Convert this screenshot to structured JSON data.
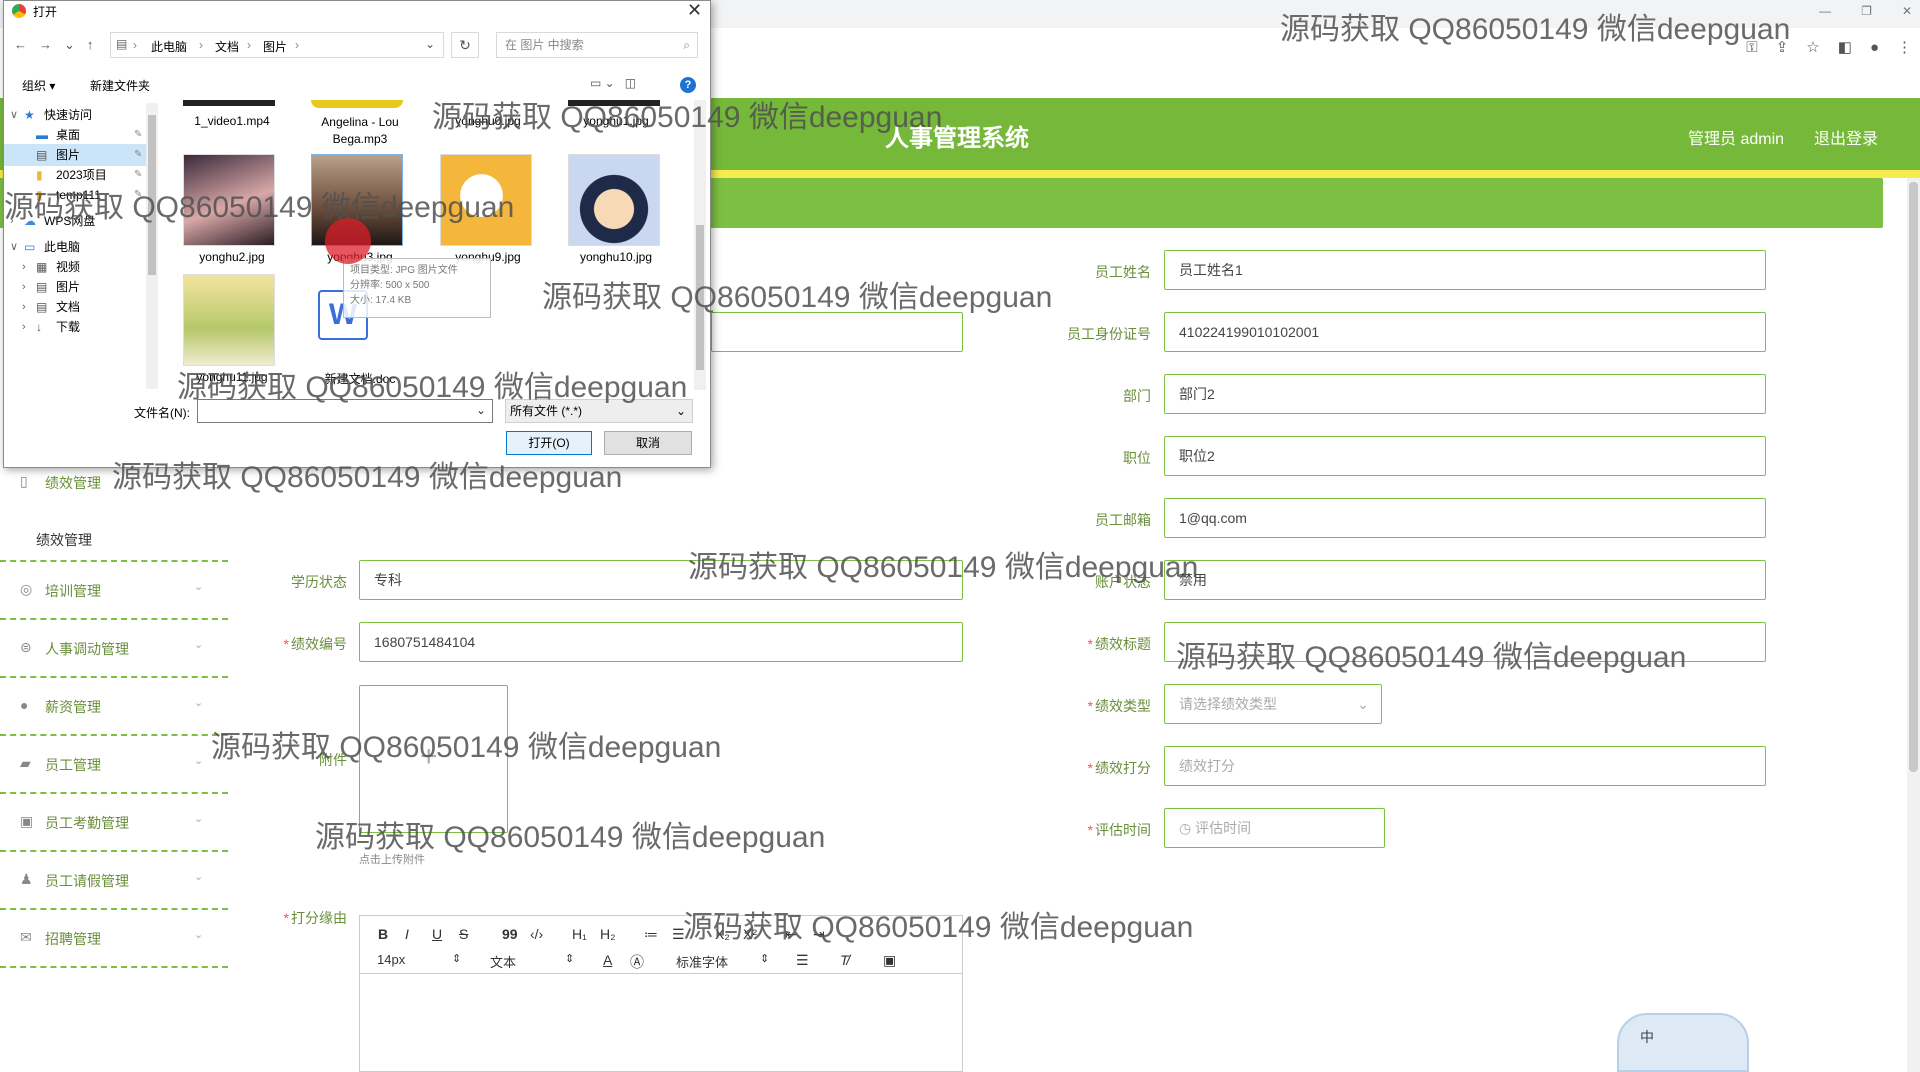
{
  "browser": {
    "window_controls": [
      "—",
      "❐",
      "✕"
    ],
    "toolbar_icons": [
      "key-icon",
      "share-icon",
      "star-icon",
      "sidebar-icon",
      "profile-icon",
      "menu-icon"
    ]
  },
  "app": {
    "title": "人事管理系统",
    "admin": "管理员 admin",
    "logout": "退出登录",
    "colors": {
      "header": "#76b83a",
      "accent_bar": "#f7ec4e",
      "label": "#6a8f3a"
    }
  },
  "sidebar": {
    "items": [
      {
        "label": "绩效管理",
        "icon": "clipboard-icon"
      },
      {
        "label": "培训管理",
        "icon": "target-icon"
      },
      {
        "label": "人事调动管理",
        "icon": "transfer-icon"
      },
      {
        "label": "薪资管理",
        "icon": "money-icon"
      },
      {
        "label": "员工管理",
        "icon": "people-icon"
      },
      {
        "label": "员工考勤管理",
        "icon": "calendar-icon"
      },
      {
        "label": "员工请假管理",
        "icon": "person-icon"
      },
      {
        "label": "招聘管理",
        "icon": "mail-icon"
      }
    ],
    "sub_item": "绩效管理"
  },
  "form": {
    "employee_name_label": "员工姓名",
    "employee_name": "员工姓名1",
    "id_card_label": "员工身份证号",
    "id_card": "410224199010102001",
    "dept_label": "部门",
    "dept": "部门2",
    "position_label": "职位",
    "position": "职位2",
    "email_label": "员工邮箱",
    "email": "1@qq.com",
    "education_label": "学历状态",
    "education": "专科",
    "account_label": "账户状态",
    "account": "禁用",
    "perf_no_label": "绩效编号",
    "perf_no": "1680751484104",
    "perf_title_label": "绩效标题",
    "perf_type_label": "绩效类型",
    "perf_type_placeholder": "请选择绩效类型",
    "attachment_label": "附件",
    "upload_hint": "点击上传附件",
    "score_label": "绩效打分",
    "score_placeholder": "绩效打分",
    "eval_time_label": "评估时间",
    "eval_time_placeholder": "评估时间",
    "reason_label": "打分缘由"
  },
  "editor": {
    "buttons": [
      "B",
      "I",
      "U",
      "S",
      "99",
      "‹/›",
      "H₁",
      "H₂",
      "≔",
      "☰",
      "X₂",
      "X²",
      "⇤",
      "⇥"
    ],
    "font_size": "14px",
    "block_type": "文本",
    "font_family": "标准字体"
  },
  "ime": {
    "char": "中"
  },
  "dialog": {
    "title": "打开",
    "close": "✕",
    "path": [
      "此电脑",
      "文档",
      "图片"
    ],
    "refresh": "↻",
    "search_placeholder": "在 图片 中搜索",
    "organize": "组织 ▾",
    "new_folder": "新建文件夹",
    "help": "?",
    "tree": [
      {
        "label": "快速访问",
        "indent": 0,
        "expander": "∨",
        "icon": "star-icon",
        "selected": false
      },
      {
        "label": "桌面",
        "indent": 1,
        "expander": "",
        "icon": "desktop-icon",
        "selected": false
      },
      {
        "label": "图片",
        "indent": 1,
        "expander": "",
        "icon": "pictures-icon",
        "selected": true
      },
      {
        "label": "2023项目",
        "indent": 1,
        "expander": "",
        "icon": "folder-icon",
        "selected": false
      },
      {
        "label": "temp111",
        "indent": 1,
        "expander": "",
        "icon": "folder-icon",
        "selected": false
      },
      {
        "label": "WPS网盘",
        "indent": 0,
        "expander": "›",
        "icon": "cloud-icon",
        "selected": false
      },
      {
        "label": "此电脑",
        "indent": 0,
        "expander": "∨",
        "icon": "computer-icon",
        "selected": false
      },
      {
        "label": "视频",
        "indent": 1,
        "expander": "›",
        "icon": "video-icon",
        "selected": false
      },
      {
        "label": "图片",
        "indent": 1,
        "expander": "›",
        "icon": "pictures-icon",
        "selected": false
      },
      {
        "label": "文档",
        "indent": 1,
        "expander": "›",
        "icon": "documents-icon",
        "selected": false
      },
      {
        "label": "下载",
        "indent": 1,
        "expander": "›",
        "icon": "download-icon",
        "selected": false
      }
    ],
    "files_row0": [
      "1_video1.mp4",
      "Angelina - Lou Bega.mp3",
      "yonghu0.jpg",
      "yonghu1.jpg"
    ],
    "files_row1": [
      "yonghu2.jpg",
      "yonghu3.jpg",
      "yonghu9.jpg",
      "yonghu10.jpg"
    ],
    "files_row2": [
      "yonghu11.jpg",
      "新建文档.doc"
    ],
    "tooltip": [
      "项目类型: JPG 图片文件",
      "分辨率: 500 x 500",
      "大小: 17.4 KB"
    ],
    "filename_label": "文件名(N):",
    "filetype": "所有文件 (*.*)",
    "open": "打开(O)",
    "cancel": "取消"
  },
  "watermark": "源码获取 QQ86050149 微信deepguan"
}
